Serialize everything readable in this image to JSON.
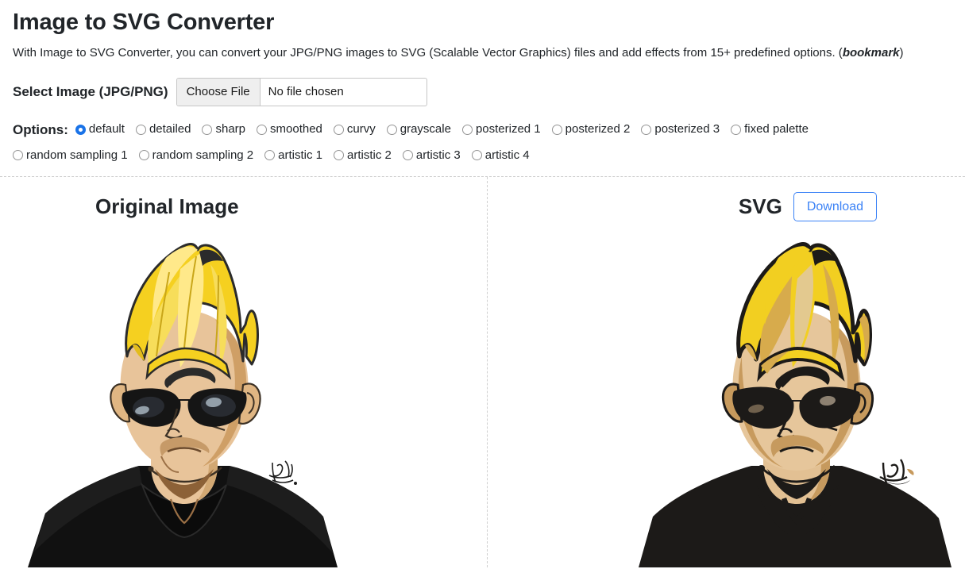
{
  "header": {
    "title": "Image to SVG Converter",
    "description_prefix": "With Image to SVG Converter, you can convert your JPG/PNG images to SVG (Scalable Vector Graphics) files and add effects from 15+ predefined options. (",
    "description_link": "bookmark",
    "description_suffix": ")"
  },
  "file_select": {
    "label": "Select Image (JPG/PNG)",
    "button_label": "Choose File",
    "file_status": "No file chosen"
  },
  "options": {
    "label": "Options:",
    "selected": "default",
    "row1": [
      {
        "label": "default",
        "checked": true
      },
      {
        "label": "detailed",
        "checked": false
      },
      {
        "label": "sharp",
        "checked": false
      },
      {
        "label": "smoothed",
        "checked": false
      },
      {
        "label": "curvy",
        "checked": false
      },
      {
        "label": "grayscale",
        "checked": false
      },
      {
        "label": "posterized 1",
        "checked": false
      },
      {
        "label": "posterized 2",
        "checked": false
      },
      {
        "label": "posterized 3",
        "checked": false
      },
      {
        "label": "fixed palette",
        "checked": false
      }
    ],
    "row2": [
      {
        "label": "random sampling 1",
        "checked": false
      },
      {
        "label": "random sampling 2",
        "checked": false
      },
      {
        "label": "artistic 1",
        "checked": false
      },
      {
        "label": "artistic 2",
        "checked": false
      },
      {
        "label": "artistic 3",
        "checked": false
      },
      {
        "label": "artistic 4",
        "checked": false
      }
    ]
  },
  "panels": {
    "left": {
      "title": "Original Image",
      "artwork_description": "cartoon portrait of a man with tall blonde pompadour hair, black sunglasses and a black t-shirt"
    },
    "right": {
      "title": "SVG",
      "download_label": "Download",
      "artwork_description": "posterized flat-color vector version of the same cartoon portrait"
    }
  },
  "colors": {
    "accent_blue": "#3b82f6",
    "radio_blue": "#1a73e8",
    "hair_yellow": "#f5d020",
    "hair_shadow": "#d3a84c",
    "skin": "#e8c49a",
    "skin_shadow": "#c49a62",
    "shirt_black": "#1c1a18",
    "divider_gray": "#cfcfcf"
  }
}
